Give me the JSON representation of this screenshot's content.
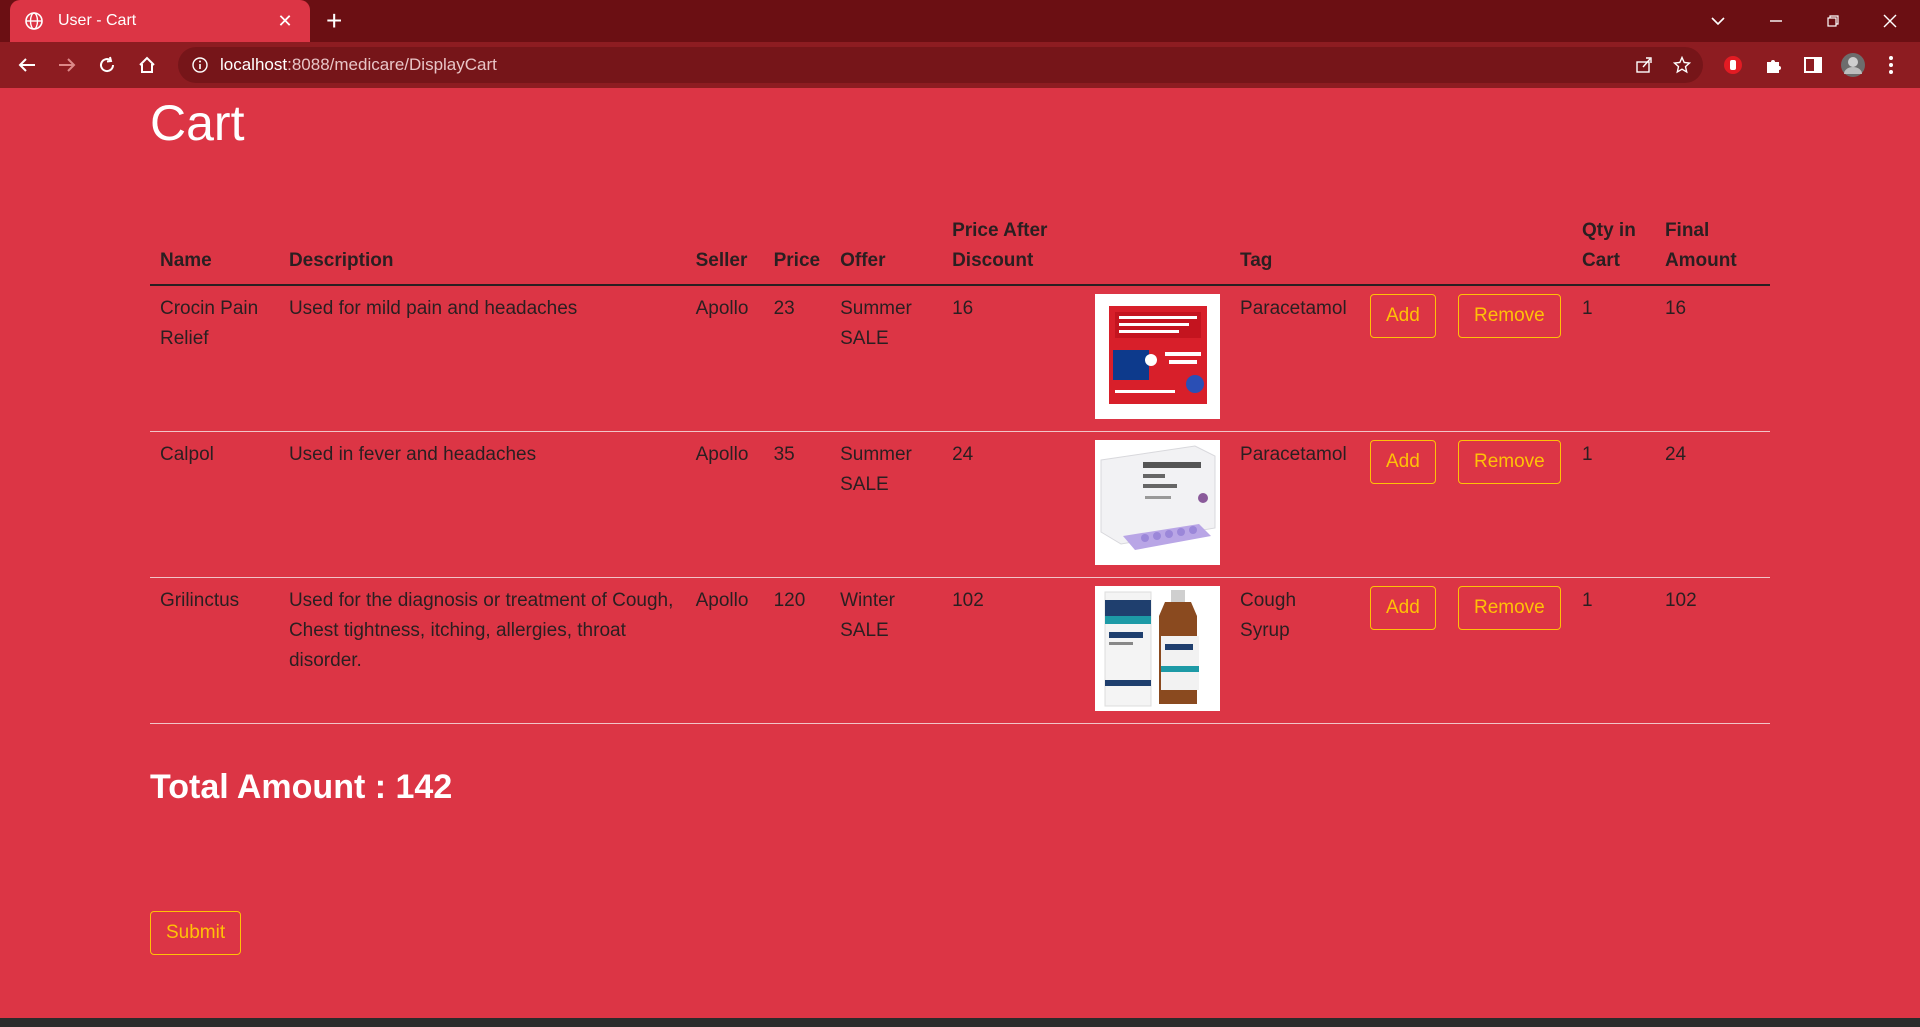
{
  "browser": {
    "tab_title": "User - Cart",
    "url_host": "localhost",
    "url_path": ":8088/medicare/DisplayCart"
  },
  "page": {
    "title": "Cart",
    "columns": [
      "Name",
      "Description",
      "Seller",
      "Price",
      "Offer",
      "Price After Discount",
      "",
      "Tag",
      "",
      "",
      "Qty in Cart",
      "Final Amount"
    ],
    "rows": [
      {
        "name": "Crocin Pain Relief",
        "description": "Used for mild pain and headaches",
        "seller": "Apollo",
        "price": "23",
        "offer": "Summer SALE",
        "price_after_discount": "16",
        "image": "crocin-box-image",
        "tag": "Paracetamol",
        "add_label": "Add",
        "remove_label": "Remove",
        "qty": "1",
        "final_amount": "16"
      },
      {
        "name": "Calpol",
        "description": "Used in fever and headaches",
        "seller": "Apollo",
        "price": "35",
        "offer": "Summer SALE",
        "price_after_discount": "24",
        "image": "calpol-box-image",
        "tag": "Paracetamol",
        "add_label": "Add",
        "remove_label": "Remove",
        "qty": "1",
        "final_amount": "24"
      },
      {
        "name": "Grilinctus",
        "description": "Used for the diagnosis or treatment of Cough, Chest tightness, itching, allergies, throat disorder.",
        "seller": "Apollo",
        "price": "120",
        "offer": "Winter SALE",
        "price_after_discount": "102",
        "image": "grilinctus-bottle-image",
        "tag": "Cough Syrup",
        "add_label": "Add",
        "remove_label": "Remove",
        "qty": "1",
        "final_amount": "102"
      }
    ],
    "total_label": "Total Amount : 142",
    "submit_label": "Submit"
  },
  "colors": {
    "page_bg": "#dc3545",
    "tabbar_bg": "#6b0f13",
    "toolbar_bg": "#8d1c21",
    "button_outline": "#ffc107"
  }
}
